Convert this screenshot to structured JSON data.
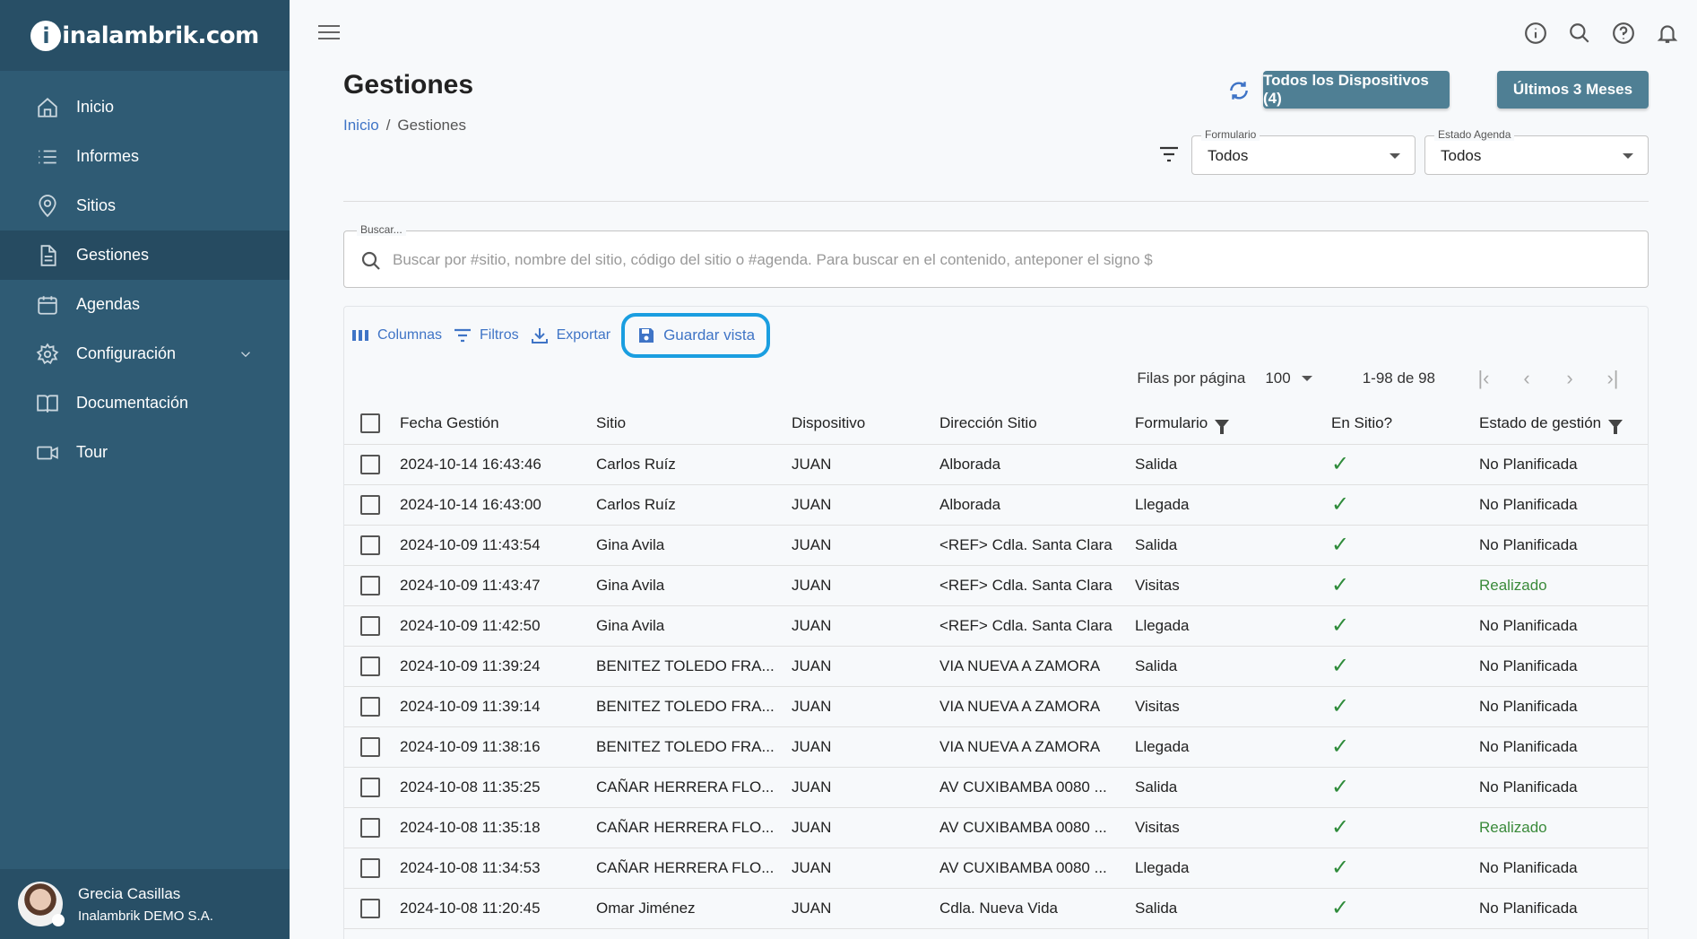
{
  "logo": "inalambrik.com",
  "sidebar": {
    "items": [
      {
        "label": "Inicio",
        "icon": "home-icon"
      },
      {
        "label": "Informes",
        "icon": "list-icon"
      },
      {
        "label": "Sitios",
        "icon": "location-pin-icon"
      },
      {
        "label": "Gestiones",
        "icon": "document-icon",
        "active": true
      },
      {
        "label": "Agendas",
        "icon": "calendar-icon"
      },
      {
        "label": "Configuración",
        "icon": "gear-icon"
      },
      {
        "label": "Documentación",
        "icon": "book-icon"
      },
      {
        "label": "Tour",
        "icon": "video-icon"
      }
    ]
  },
  "user": {
    "name": "Grecia Casillas",
    "org": "Inalambrik DEMO S.A."
  },
  "header": {
    "title": "Gestiones",
    "breadcrumb": {
      "home": "Inicio",
      "sep": "/",
      "current": "Gestiones"
    },
    "devices_button": "Todos los Dispositivos (4)",
    "period_button": "Últimos 3 Meses",
    "formulario": {
      "label": "Formulario",
      "value": "Todos"
    },
    "estado": {
      "label": "Estado Agenda",
      "value": "Todos"
    }
  },
  "search": {
    "label": "Buscar...",
    "placeholder": "Buscar por #sitio, nombre del sitio, código del sitio o #agenda. Para buscar en el contenido, anteponer el signo $"
  },
  "toolbar": {
    "columns": "Columnas",
    "filters": "Filtros",
    "export": "Exportar",
    "save_view": "Guardar vista"
  },
  "pager": {
    "rows_label": "Filas por página",
    "rows_value": "100",
    "range": "1-98 de 98"
  },
  "table": {
    "headers": [
      "Fecha Gestión",
      "Sitio",
      "Dispositivo",
      "Dirección Sitio",
      "Formulario",
      "En Sitio?",
      "Estado de gestión"
    ],
    "rows": [
      {
        "fecha": "2024-10-14 16:43:46",
        "sitio": "Carlos Ruíz",
        "dispositivo": "JUAN",
        "direccion": "Alborada",
        "formulario": "Salida",
        "estado": "No Planificada"
      },
      {
        "fecha": "2024-10-14 16:43:00",
        "sitio": "Carlos Ruíz",
        "dispositivo": "JUAN",
        "direccion": "Alborada",
        "formulario": "Llegada",
        "estado": "No Planificada"
      },
      {
        "fecha": "2024-10-09 11:43:54",
        "sitio": "Gina Avila",
        "dispositivo": "JUAN",
        "direccion": "<REF> Cdla. Santa Clara",
        "formulario": "Salida",
        "estado": "No Planificada"
      },
      {
        "fecha": "2024-10-09 11:43:47",
        "sitio": "Gina Avila",
        "dispositivo": "JUAN",
        "direccion": "<REF> Cdla. Santa Clara",
        "formulario": "Visitas",
        "estado": "Realizado"
      },
      {
        "fecha": "2024-10-09 11:42:50",
        "sitio": "Gina Avila",
        "dispositivo": "JUAN",
        "direccion": "<REF> Cdla. Santa Clara",
        "formulario": "Llegada",
        "estado": "No Planificada"
      },
      {
        "fecha": "2024-10-09 11:39:24",
        "sitio": "BENITEZ TOLEDO FRA...",
        "dispositivo": "JUAN",
        "direccion": "VIA NUEVA A ZAMORA",
        "formulario": "Salida",
        "estado": "No Planificada"
      },
      {
        "fecha": "2024-10-09 11:39:14",
        "sitio": "BENITEZ TOLEDO FRA...",
        "dispositivo": "JUAN",
        "direccion": "VIA NUEVA A ZAMORA",
        "formulario": "Visitas",
        "estado": "No Planificada"
      },
      {
        "fecha": "2024-10-09 11:38:16",
        "sitio": "BENITEZ TOLEDO FRA...",
        "dispositivo": "JUAN",
        "direccion": "VIA NUEVA A ZAMORA",
        "formulario": "Llegada",
        "estado": "No Planificada"
      },
      {
        "fecha": "2024-10-08 11:35:25",
        "sitio": "CAÑAR HERRERA FLO...",
        "dispositivo": "JUAN",
        "direccion": "AV CUXIBAMBA 0080 ...",
        "formulario": "Salida",
        "estado": "No Planificada"
      },
      {
        "fecha": "2024-10-08 11:35:18",
        "sitio": "CAÑAR HERRERA FLO...",
        "dispositivo": "JUAN",
        "direccion": "AV CUXIBAMBA 0080 ...",
        "formulario": "Visitas",
        "estado": "Realizado"
      },
      {
        "fecha": "2024-10-08 11:34:53",
        "sitio": "CAÑAR HERRERA FLO...",
        "dispositivo": "JUAN",
        "direccion": "AV CUXIBAMBA 0080 ...",
        "formulario": "Llegada",
        "estado": "No Planificada"
      },
      {
        "fecha": "2024-10-08 11:20:45",
        "sitio": "Omar Jiménez",
        "dispositivo": "JUAN",
        "direccion": "Cdla. Nueva Vida",
        "formulario": "Salida",
        "estado": "No Planificada"
      }
    ]
  },
  "colors": {
    "sidebar": "#2f5b74",
    "primary_button": "#4f7f94",
    "accent": "#3f74c6",
    "highlight": "#1a9ee0",
    "success": "#2e8b3a"
  }
}
